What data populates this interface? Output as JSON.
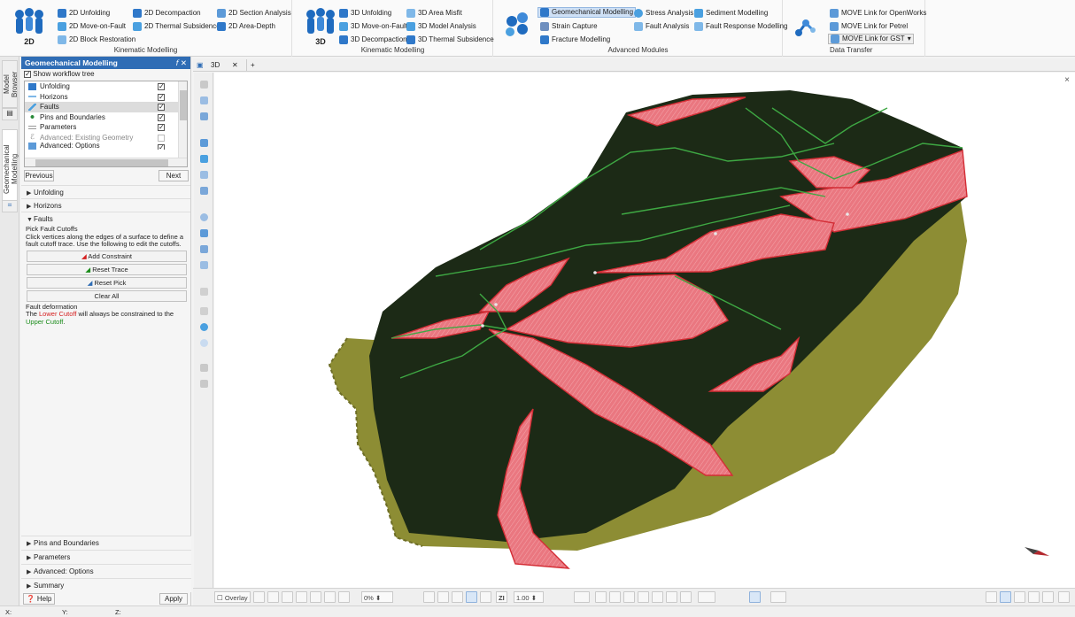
{
  "ribbon": {
    "kinematic2d": {
      "logo_caption": "2D",
      "items": [
        "2D Unfolding",
        "2D Move-on-Fault",
        "2D Block Restoration",
        "2D Decompaction",
        "2D Thermal Subsidence",
        "2D Section Analysis",
        "2D Area-Depth"
      ],
      "title": "Kinematic Modelling"
    },
    "kinematic3d": {
      "logo_caption": "3D",
      "items": [
        "3D Unfolding",
        "3D Move-on-Fault",
        "3D Decompaction",
        "3D Area Misfit",
        "3D Model Analysis",
        "3D Thermal Subsidence"
      ],
      "title": "Kinematic Modelling"
    },
    "advanced": {
      "items": [
        "Geomechanical Modelling",
        "Strain Capture",
        "Fracture Modelling",
        "Stress Analysis",
        "Fault Analysis",
        "Sediment Modelling",
        "Fault Response Modelling"
      ],
      "title": "Advanced Modules"
    },
    "transfer": {
      "items": [
        "MOVE Link for OpenWorks",
        "MOVE Link for Petrel",
        "MOVE Link for GST"
      ],
      "title": "Data Transfer"
    }
  },
  "vtabs": [
    "Model Browser",
    "Geomechanical Modelling"
  ],
  "panel": {
    "title": "Geomechanical Modelling",
    "header_buttons": "𝘧  ✕",
    "show_workflow": "Show workflow tree",
    "workflow": [
      {
        "label": "Unfolding",
        "checked": true
      },
      {
        "label": "Horizons",
        "checked": true
      },
      {
        "label": "Faults",
        "checked": true
      },
      {
        "label": "Pins and Boundaries",
        "checked": true
      },
      {
        "label": "Parameters",
        "checked": true
      },
      {
        "label": "Advanced: Existing Geometry",
        "checked": false
      },
      {
        "label": "Advanced: Options",
        "checked": true
      }
    ],
    "previous": "Previous",
    "next": "Next",
    "sections_top": [
      "Unfolding",
      "Horizons",
      "Faults"
    ],
    "pick_title": "Pick Fault Cutoffs",
    "pick_desc": "Click vertices along the edges of a surface to define a fault cutoff trace. Use the following to edit the cutoffs.",
    "buttons": [
      "Add Constraint",
      "Reset Trace",
      "Reset Pick",
      "Clear All"
    ],
    "fault_deform_title": "Fault deformation",
    "fault_deform_1": "The ",
    "fault_deform_lower": "Lower Cutoff",
    "fault_deform_2": " will always be constrained to the ",
    "fault_deform_upper": "Upper Cutoff",
    "fault_deform_3": ".",
    "sections_bottom": [
      "Pins and Boundaries",
      "Parameters",
      "Advanced: Options",
      "Summary"
    ],
    "help": "Help",
    "apply": "Apply"
  },
  "doc_tabs": {
    "tab": "3D",
    "close": "✕",
    "add": "+"
  },
  "viewport": {
    "close": "×"
  },
  "bottom_toolbar": {
    "overlay": "Overlay",
    "opacity": "0%",
    "zi": "ZI",
    "zoom": "1.00"
  },
  "status": {
    "x": "X:",
    "y": "Y:",
    "z": "Z:"
  },
  "colors": {
    "accent": "#2f6db5",
    "surface": "#1c2a16",
    "fault": "#e9737d",
    "edge": "#3ea843",
    "skirt": "#8d8d34"
  }
}
